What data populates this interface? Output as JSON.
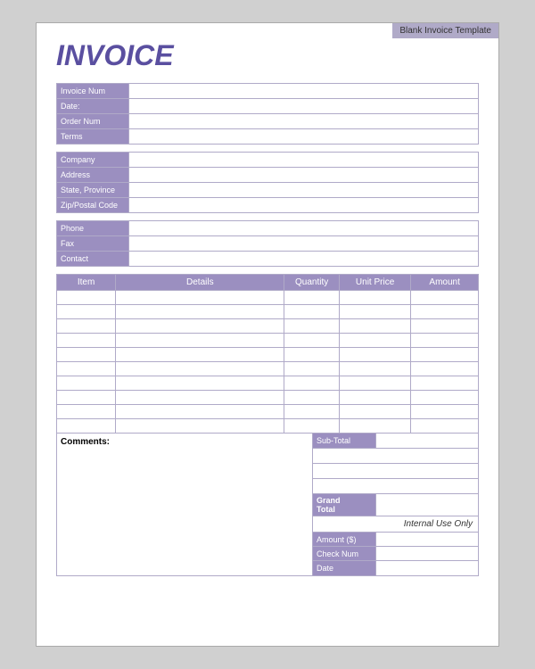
{
  "template_label": "Blank Invoice Template",
  "invoice_title": "INVOICE",
  "info_section_1": {
    "rows": [
      {
        "label": "Invoice Num",
        "value": ""
      },
      {
        "label": "Date:",
        "value": ""
      },
      {
        "label": "Order Num",
        "value": ""
      },
      {
        "label": "Terms",
        "value": ""
      }
    ]
  },
  "info_section_2": {
    "rows": [
      {
        "label": "Company",
        "value": ""
      },
      {
        "label": "Address",
        "value": ""
      },
      {
        "label": "State, Province",
        "value": ""
      },
      {
        "label": "Zip/Postal Code",
        "value": ""
      }
    ]
  },
  "info_section_3": {
    "rows": [
      {
        "label": "Phone",
        "value": ""
      },
      {
        "label": "Fax",
        "value": ""
      },
      {
        "label": "Contact",
        "value": ""
      }
    ]
  },
  "table": {
    "headers": [
      "Item",
      "Details",
      "Quantity",
      "Unit Price",
      "Amount"
    ],
    "rows": 10
  },
  "comments_label": "Comments:",
  "totals": {
    "sub_total_label": "Sub-Total",
    "blank_rows": 3,
    "grand_total_label": "Grand\nTotal",
    "internal_use": "Internal Use Only",
    "payment_rows": [
      {
        "label": "Amount ($)",
        "value": ""
      },
      {
        "label": "Check Num",
        "value": ""
      },
      {
        "label": "Date",
        "value": ""
      }
    ]
  }
}
